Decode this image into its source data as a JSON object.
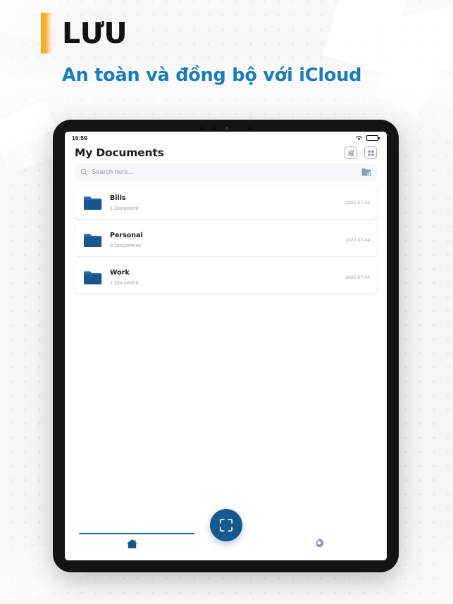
{
  "brand": {
    "title": "LƯU",
    "subtitle": "An toàn và đồng bộ với iCloud",
    "accent_bar_color": "#F9A51A",
    "subtitle_color": "#1C7CB5"
  },
  "device": {
    "status_bar": {
      "time": "16:59",
      "wifi_icon": "wifi-icon",
      "battery_icon": "battery-full-icon"
    }
  },
  "app": {
    "header": {
      "title": "My Documents",
      "actions": [
        {
          "name": "sort-filter-button",
          "icon": "sort-list-icon"
        },
        {
          "name": "grid-view-button",
          "icon": "grid-view-icon"
        }
      ]
    },
    "search": {
      "placeholder": "Search here...",
      "value": "",
      "search_icon": "search-icon",
      "new_folder_icon": "new-folder-icon"
    },
    "folders": [
      {
        "name": "Bills",
        "count": "1 Document",
        "date": "2022-07-04",
        "icon": "folder-icon"
      },
      {
        "name": "Personal",
        "count": "3 Documents",
        "date": "2022-07-04",
        "icon": "folder-icon"
      },
      {
        "name": "Work",
        "count": "1 Document",
        "date": "2022-07-04",
        "icon": "folder-icon"
      }
    ],
    "bottom_bar": {
      "home_tab": {
        "name": "home-tab",
        "icon": "home-icon",
        "active": true
      },
      "scan_button": {
        "name": "scan-button",
        "icon": "scan-frame-icon",
        "color": "#155A8F"
      },
      "settings_tab": {
        "name": "settings-tab",
        "icon": "gear-icon",
        "active": false
      }
    }
  },
  "colors": {
    "folder_blue": "#18548F",
    "accent_blue": "#155A8F",
    "inactive_gray": "#8C9BB5",
    "page_background": "#F2F2F3"
  }
}
